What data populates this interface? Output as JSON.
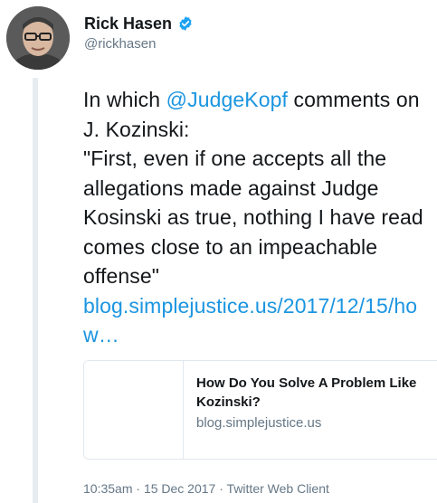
{
  "user": {
    "display_name": "Rick Hasen",
    "handle": "@rickhasen"
  },
  "tweet": {
    "text_intro": "In which ",
    "mention": "@JudgeKopf",
    "text_after_mention": " comments on J. Kozinski:",
    "quote": "\"First, even if one accepts all the allegations made against Judge Kosinski as true, nothing I have read comes close to an impeachable offense\"",
    "link": "blog.simplejustice.us/2017/12/15/how…"
  },
  "card": {
    "title": "How Do You Solve A Problem Like Kozinski?",
    "domain": "blog.simplejustice.us"
  },
  "meta": {
    "time": "10:35am",
    "date": "15 Dec 2017",
    "client": "Twitter Web Client",
    "separator": " · "
  },
  "colors": {
    "link": "#1b95e0",
    "verified": "#1da1f2",
    "secondary_text": "#657786"
  },
  "icons": {
    "verified": "verified-badge-icon"
  }
}
